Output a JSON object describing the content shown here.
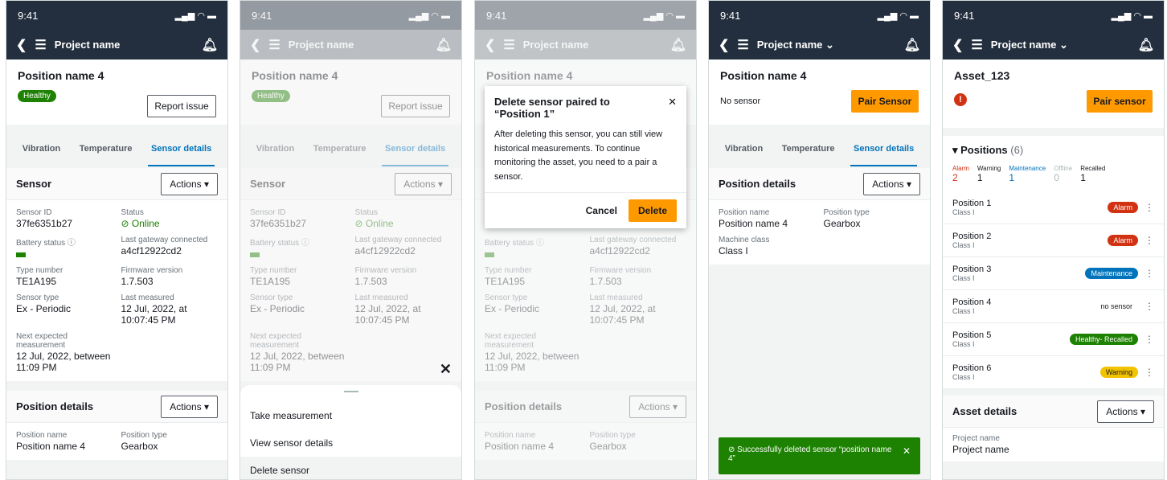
{
  "status": {
    "time": "9:41"
  },
  "nav": {
    "project": "Project name",
    "project_dd": "Project name ⌄"
  },
  "position": {
    "title": "Position name 4",
    "health": "Healthy",
    "report_btn": "Report issue",
    "no_sensor": "No sensor",
    "pair_btn": "Pair Sensor"
  },
  "tabs": {
    "vibration": "Vibration",
    "temperature": "Temperature",
    "sensor_details": "Sensor details"
  },
  "sensor": {
    "title": "Sensor",
    "actions": "Actions ▾",
    "id_label": "Sensor ID",
    "id": "37fe6351b27",
    "status_label": "Status",
    "status": "⊘ Online",
    "battery_label": "Battery status ⓘ",
    "gateway_label": "Last gateway connected",
    "gateway": "a4cf12922cd2",
    "type_label": "Type number",
    "type": "TE1A195",
    "fw_label": "Firmware version",
    "fw": "1.7.503",
    "stype_label": "Sensor type",
    "stype": "Ex - Periodic",
    "measured_label": "Last measured",
    "measured": "12 Jul, 2022, at 10:07:45 PM",
    "next_label": "Next expected measurement",
    "next": "12 Jul, 2022, between 11:09 PM"
  },
  "posdetails": {
    "title": "Position details",
    "actions": "Actions ▾",
    "name_label": "Position name",
    "name": "Position name 4",
    "type_label": "Position type",
    "type": "Gearbox",
    "class_label": "Machine class",
    "class": "Class I"
  },
  "sheet": {
    "close": "✕",
    "items": [
      "Take measurement",
      "View sensor details",
      "Delete sensor"
    ]
  },
  "modal": {
    "title": "Delete sensor paired to “Position 1”",
    "close": "✕",
    "body": "After deleting this sensor, you can still view historical measurements. To continue monitoring the asset, you need to a pair a sensor.",
    "cancel": "Cancel",
    "delete": "Delete"
  },
  "toast": {
    "text": "⊘ Successfully deleted sensor “position name 4”",
    "close": "✕"
  },
  "asset": {
    "title": "Asset_123",
    "pair_btn": "Pair sensor",
    "positions_title": "▾ Positions",
    "positions_count": "(6)",
    "stats": [
      {
        "label": "Alarm",
        "value": "2",
        "color": "#d13212"
      },
      {
        "label": "Warning",
        "value": "1",
        "color": "#16191f"
      },
      {
        "label": "Maintenance",
        "value": "1",
        "color": "#0073bb"
      },
      {
        "label": "Offline",
        "value": "0",
        "color": "#aab7b8"
      },
      {
        "label": "Recalled",
        "value": "1",
        "color": "#16191f"
      }
    ],
    "rows": [
      {
        "name": "Position 1",
        "class": "Class I",
        "badge": "Alarm",
        "color": "#d13212",
        "text": "#fff"
      },
      {
        "name": "Position 2",
        "class": "Class I",
        "badge": "Alarm",
        "color": "#d13212",
        "text": "#fff"
      },
      {
        "name": "Position 3",
        "class": "Class I",
        "badge": "Maintenance",
        "color": "#0073bb",
        "text": "#fff"
      },
      {
        "name": "Position 4",
        "class": "Class I",
        "badge": "no sensor",
        "color": "transparent",
        "text": "#16191f"
      },
      {
        "name": "Position 5",
        "class": "Class I",
        "badge": "Healthy- Recalled",
        "color": "#1d8102",
        "text": "#fff"
      },
      {
        "name": "Position 6",
        "class": "Class I",
        "badge": "Warning",
        "color": "#f2c300",
        "text": "#16191f"
      }
    ],
    "details_title": "Asset details",
    "details_actions": "Actions ▾",
    "pname_label": "Project name",
    "pname": "Project name"
  },
  "colors": {
    "nav": "#232f3e",
    "accent": "#ff9900",
    "link": "#0073bb",
    "healthy": "#1d8102"
  }
}
